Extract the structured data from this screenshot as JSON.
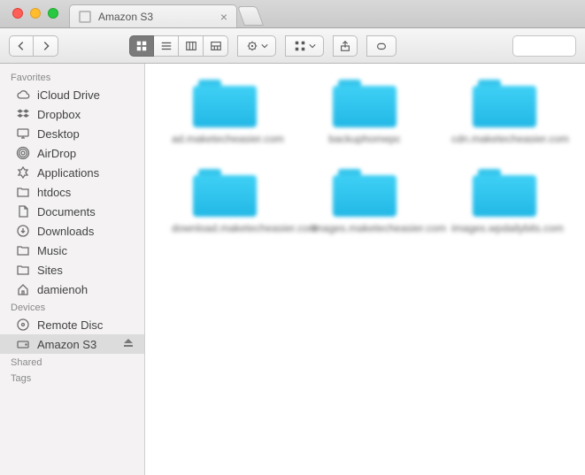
{
  "browser": {
    "tab_title": "Amazon S3"
  },
  "sidebar": {
    "groups": [
      {
        "title": "Favorites",
        "items": [
          {
            "icon": "cloud-icon",
            "label": "iCloud Drive"
          },
          {
            "icon": "dropbox-icon",
            "label": "Dropbox"
          },
          {
            "icon": "desktop-icon",
            "label": "Desktop"
          },
          {
            "icon": "airdrop-icon",
            "label": "AirDrop"
          },
          {
            "icon": "applications-icon",
            "label": "Applications"
          },
          {
            "icon": "folder-icon",
            "label": "htdocs"
          },
          {
            "icon": "documents-icon",
            "label": "Documents"
          },
          {
            "icon": "downloads-icon",
            "label": "Downloads"
          },
          {
            "icon": "folder-icon",
            "label": "Music"
          },
          {
            "icon": "folder-icon",
            "label": "Sites"
          },
          {
            "icon": "home-icon",
            "label": "damienoh"
          }
        ]
      },
      {
        "title": "Devices",
        "items": [
          {
            "icon": "disc-icon",
            "label": "Remote Disc"
          },
          {
            "icon": "drive-icon",
            "label": "Amazon S3",
            "selected": true,
            "ejectable": true
          }
        ]
      },
      {
        "title": "Shared",
        "items": []
      },
      {
        "title": "Tags",
        "items": []
      }
    ]
  },
  "content": {
    "folders": [
      {
        "name": "ad.maketecheasier.com"
      },
      {
        "name": "backuphomepc"
      },
      {
        "name": "cdn.maketecheasier.com"
      },
      {
        "name": "download.maketecheasier.com"
      },
      {
        "name": "images.maketecheasier.com"
      },
      {
        "name": "images.wpdailybits.com"
      }
    ]
  }
}
